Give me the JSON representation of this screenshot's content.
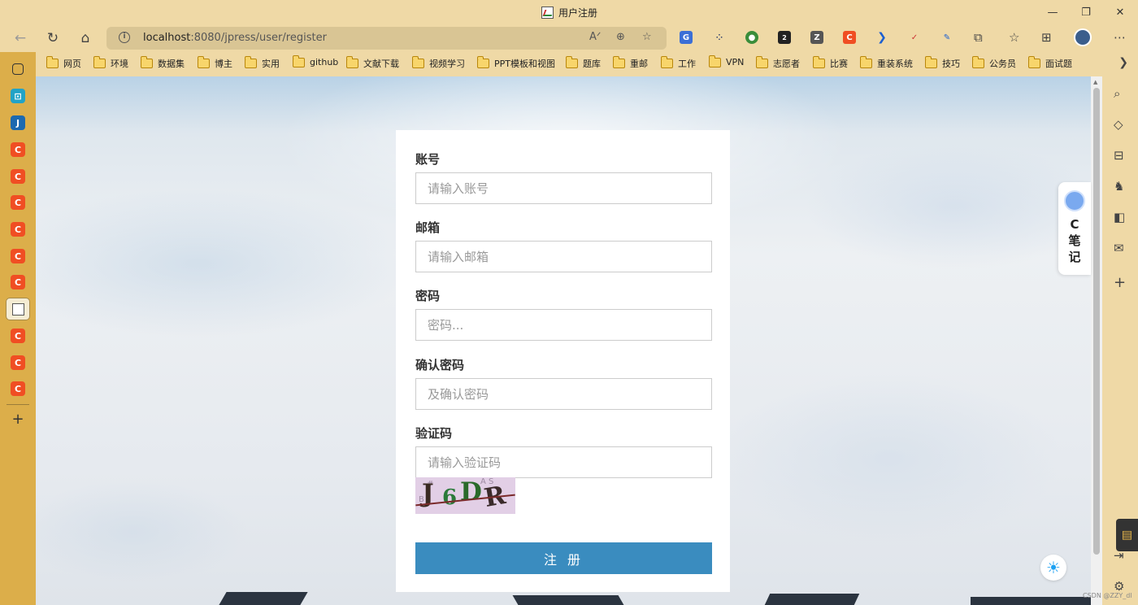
{
  "window": {
    "title": "用户注册",
    "minimize": "—",
    "restore": "❐",
    "close": "✕"
  },
  "toolbar": {
    "url_host": "localhost",
    "url_rest": ":8080/jpress/user/register"
  },
  "bookmarks": [
    "网页",
    "环境",
    "数据集",
    "博主",
    "实用",
    "github",
    "文献下载",
    "视频学习",
    "PPT模板和视图",
    "题库",
    "重邮",
    "工作",
    "VPN",
    "志愿者",
    "比赛",
    "重装系统",
    "技巧",
    "公务员",
    "面试题"
  ],
  "sidebar_left": {
    "j_label": "J",
    "c_label": "C"
  },
  "form": {
    "account_label": "账号",
    "account_placeholder": "请输入账号",
    "email_label": "邮箱",
    "email_placeholder": "请输入邮箱",
    "password_label": "密码",
    "password_placeholder": "密码...",
    "confirm_label": "确认密码",
    "confirm_placeholder": "及确认密码",
    "captcha_label": "验证码",
    "captcha_placeholder": "请输入验证码",
    "captcha_chars": [
      "J",
      "6",
      "D",
      "R"
    ],
    "submit_label": "注 册"
  },
  "note_widget": {
    "line1": "C",
    "line2": "笔",
    "line3": "记"
  },
  "extension_badge": "2",
  "watermark": "CSDN @ZZY_dl"
}
